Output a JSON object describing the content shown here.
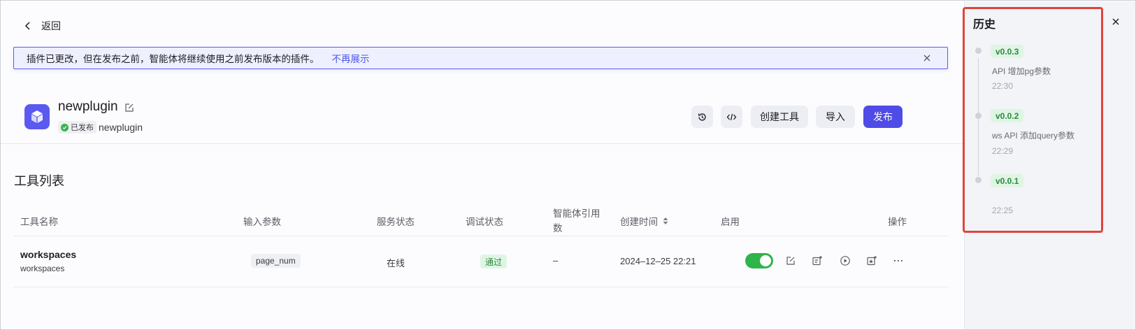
{
  "nav": {
    "back_label": "返回"
  },
  "banner": {
    "message": "插件已更改，但在发布之前，智能体将继续使用之前发布版本的插件。",
    "link": "不再展示"
  },
  "plugin": {
    "name": "newplugin",
    "status_badge": "已发布",
    "subtitle": "newplugin"
  },
  "toolbar": {
    "history_icon": "history-icon",
    "code_icon": "code-icon",
    "create_tool": "创建工具",
    "import": "导入",
    "publish": "发布"
  },
  "section": {
    "title": "工具列表"
  },
  "table": {
    "columns": {
      "name": "工具名称",
      "input_params": "输入参数",
      "service_status": "服务状态",
      "debug_status": "调试状态",
      "agent_refs_line1": "智能体引用",
      "agent_refs_line2": "数",
      "created_time": "创建时间",
      "enabled": "启用",
      "actions": "操作"
    },
    "rows": [
      {
        "name": "workspaces",
        "description": "workspaces",
        "input_param": "page_num",
        "service_status": "在线",
        "debug_status": "通过",
        "agent_refs": "–",
        "created_time": "2024–12–25 22:21",
        "enabled": true
      }
    ]
  },
  "history": {
    "title": "历史",
    "versions": [
      {
        "version": "v0.0.3",
        "description": "API 增加pg参数",
        "time": "22:30"
      },
      {
        "version": "v0.0.2",
        "description": "ws API 添加query参数",
        "time": "22:29"
      },
      {
        "version": "v0.0.1",
        "description": "",
        "time": "22:25"
      }
    ]
  },
  "colors": {
    "primary": "#4f4be6",
    "success": "#2fb44a",
    "highlight": "#e0443e"
  }
}
